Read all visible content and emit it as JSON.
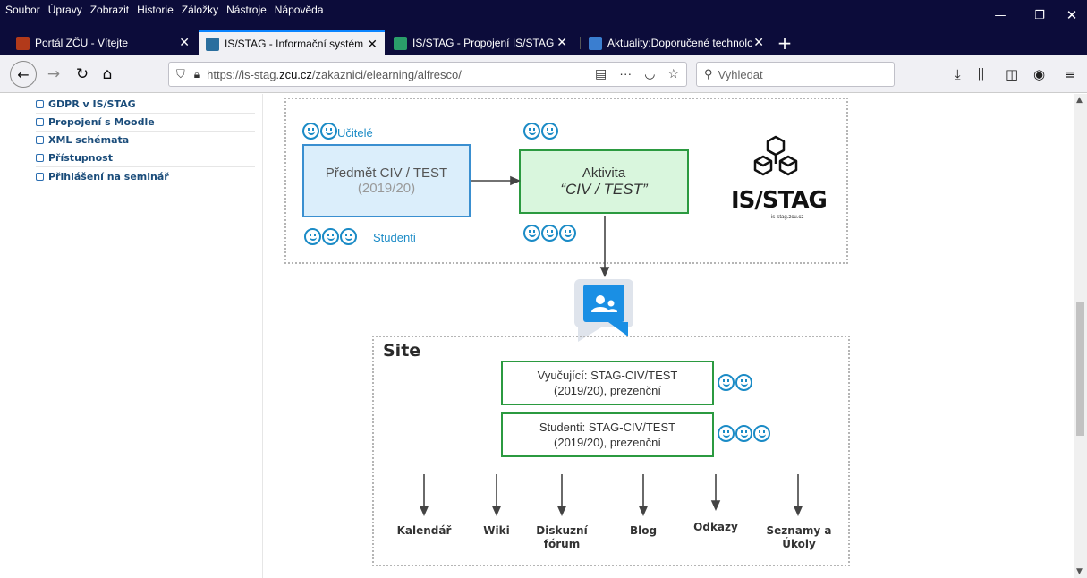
{
  "menu": [
    "Soubor",
    "Úpravy",
    "Zobrazit",
    "Historie",
    "Záložky",
    "Nástroje",
    "Nápověda"
  ],
  "window_controls": {
    "minimize": "—",
    "maximize": "❐",
    "close": "✕"
  },
  "tabs": [
    {
      "title": "Portál ZČU - Vítejte",
      "active": false,
      "favicon_color": "#b23a1a"
    },
    {
      "title": "IS/STAG - Informační systém stu",
      "active": true,
      "favicon_color": "#2a6e9e"
    },
    {
      "title": "IS/STAG - Propojení IS/STAG s M",
      "active": false,
      "favicon_color": "#2a9e6a"
    },
    {
      "title": "Aktuality:Doporučené technolo",
      "active": false,
      "favicon_color": "#3a7ed0"
    }
  ],
  "nav": {
    "url_prefix": "https://is-stag.",
    "url_domain": "zcu.cz",
    "url_path": "/zakaznici/elearning/alfresco/",
    "search_placeholder": "Vyhledat"
  },
  "sidebar": {
    "items": [
      {
        "label": "GDPR v IS/STAG"
      },
      {
        "label": "Propojení s Moodle"
      },
      {
        "label": "XML schémata"
      },
      {
        "label": "Přístupnost"
      },
      {
        "label": "Přihlášení na seminář"
      }
    ]
  },
  "diagram": {
    "teachers_label": "Učitelé",
    "students_label": "Studenti",
    "course_box": {
      "line1": "Předmět CIV / TEST",
      "line2": "(2019/20)"
    },
    "activity_box": {
      "line1": "Aktivita",
      "line2": "“CIV / TEST”"
    },
    "logo_text": "IS/STAG",
    "logo_sub": "is-stag.zcu.cz",
    "site_title": "Site",
    "group_teachers": {
      "line1": "Vyučující: STAG-CIV/TEST",
      "line2": "(2019/20), prezenční"
    },
    "group_students": {
      "line1": "Studenti: STAG-CIV/TEST",
      "line2": "(2019/20), prezenční"
    },
    "tools": [
      {
        "line1": "Kalendář",
        "line2": ""
      },
      {
        "line1": "Wiki",
        "line2": ""
      },
      {
        "line1": "Diskuzní",
        "line2": "fórum"
      },
      {
        "line1": "Blog",
        "line2": ""
      },
      {
        "line1": "Odkazy",
        "line2": ""
      },
      {
        "line1": "Seznamy a",
        "line2": "Úkoly"
      }
    ]
  },
  "colors": {
    "title_bg": "#0c0c3a",
    "accent_blue": "#1b8bc6",
    "accent_green": "#2b9a40"
  }
}
